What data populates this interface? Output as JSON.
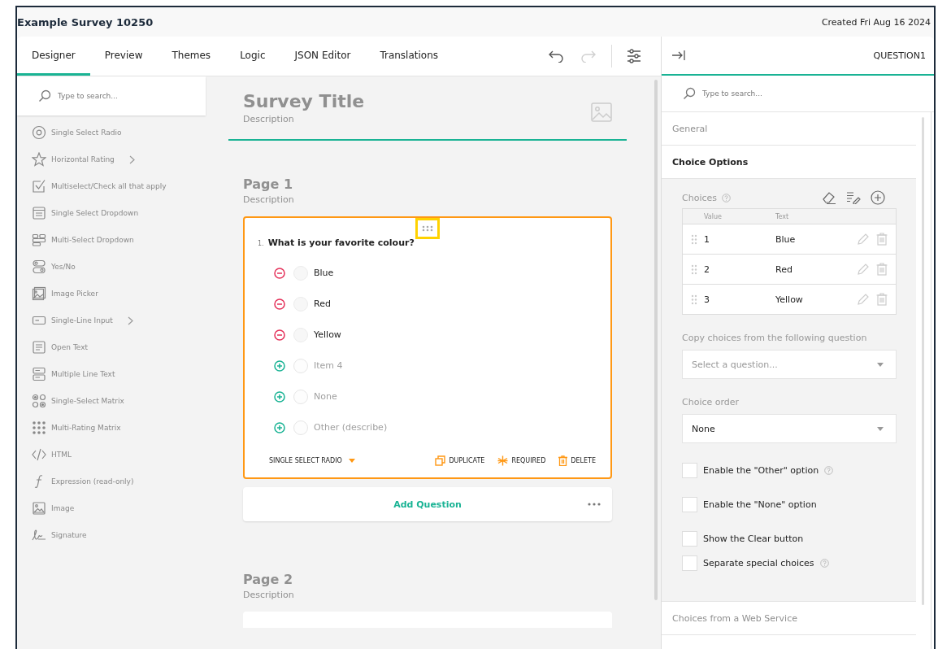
{
  "window": {
    "title": "Example Survey 10250",
    "created": "Created Fri Aug 16 2024"
  },
  "tabs": [
    {
      "label": "Designer",
      "selected": true
    },
    {
      "label": "Preview",
      "selected": false
    },
    {
      "label": "Themes",
      "selected": false
    },
    {
      "label": "Logic",
      "selected": false
    },
    {
      "label": "JSON Editor",
      "selected": false
    },
    {
      "label": "Translations",
      "selected": false
    }
  ],
  "toolbar": [
    {
      "kind": "undo",
      "disabled": false
    },
    {
      "kind": "redo",
      "disabled": true
    },
    {
      "kind": "settings",
      "disabled": false
    }
  ],
  "toolbox": {
    "search": {
      "placeholder": "Type to search..."
    },
    "items": [
      {
        "label": "Single Select Radio",
        "kind": "radio",
        "submenu": false
      },
      {
        "label": "Horizontal Rating",
        "kind": "star",
        "submenu": true
      },
      {
        "label": "Multiselect/Check all that apply",
        "kind": "check",
        "submenu": false
      },
      {
        "label": "Single Select Dropdown",
        "kind": "dropdown",
        "submenu": false
      },
      {
        "label": "Multi-Select Dropdown",
        "kind": "tags",
        "submenu": false
      },
      {
        "label": "Yes/No",
        "kind": "toggle",
        "submenu": false
      },
      {
        "label": "Image Picker",
        "kind": "imagepicker",
        "submenu": false
      },
      {
        "label": "Single-Line Input",
        "kind": "input",
        "submenu": true
      },
      {
        "label": "Open Text",
        "kind": "text",
        "submenu": false
      },
      {
        "label": "Multiple Line Text",
        "kind": "multitext",
        "submenu": false
      },
      {
        "label": "Single-Select Matrix",
        "kind": "matrix",
        "submenu": false
      },
      {
        "label": "Multi-Rating Matrix",
        "kind": "dots",
        "submenu": false
      },
      {
        "label": "HTML",
        "kind": "code",
        "submenu": false
      },
      {
        "label": "Expression (read-only)",
        "kind": "function",
        "submenu": false
      },
      {
        "label": "Image",
        "kind": "image",
        "submenu": false
      },
      {
        "label": "Signature",
        "kind": "signature",
        "submenu": false
      }
    ]
  },
  "survey": {
    "title": "Survey Title",
    "description": "Description",
    "pages": [
      {
        "title": "Page 1",
        "description": "Description",
        "question": {
          "number": "1.",
          "title": "What is your favorite colour?",
          "handle_selected": true,
          "choices": [
            {
              "label": "Blue",
              "kind": "item",
              "checked": false
            },
            {
              "label": "Red",
              "kind": "item",
              "checked": false
            },
            {
              "label": "Yellow",
              "kind": "item",
              "checked": false
            },
            {
              "label": "Item 4",
              "kind": "new",
              "checked": false
            },
            {
              "label": "None",
              "kind": "new",
              "checked": false
            },
            {
              "label": "Other (describe)",
              "kind": "new",
              "checked": false
            }
          ],
          "type": "SINGLE SELECT RADIO",
          "actions": [
            {
              "label": "DUPLICATE",
              "kind": "duplicate"
            },
            {
              "label": "REQUIRED",
              "kind": "required"
            },
            {
              "label": "DELETE",
              "kind": "delete"
            }
          ]
        },
        "add_question": "Add Question"
      },
      {
        "title": "Page 2",
        "description": "Description"
      }
    ]
  },
  "properties": {
    "title": "QUESTION1",
    "search": {
      "placeholder": "Type to search..."
    },
    "sections": [
      {
        "label": "General",
        "expanded": false
      },
      {
        "label": "Choice Options",
        "expanded": true
      },
      {
        "label": "Choices from a Web Service",
        "expanded": false
      }
    ],
    "choice_options": {
      "choices_label": "Choices",
      "columns": [
        "Value",
        "Text"
      ],
      "rows": [
        {
          "value": "1",
          "text": "Blue"
        },
        {
          "value": "2",
          "text": "Red"
        },
        {
          "value": "3",
          "text": "Yellow"
        }
      ],
      "copy_label": "Copy choices from the following question",
      "copy_placeholder": "Select a question...",
      "order_label": "Choice order",
      "order_value": "None",
      "options": [
        {
          "label": "Enable the \"Other\" option",
          "checked": false,
          "help": true
        },
        {
          "label": "Enable the \"None\" option",
          "checked": false,
          "help": false
        },
        {
          "label": "Show the Clear button",
          "checked": false,
          "help": false
        },
        {
          "label": "Separate special choices",
          "checked": false,
          "help": true
        }
      ]
    }
  }
}
